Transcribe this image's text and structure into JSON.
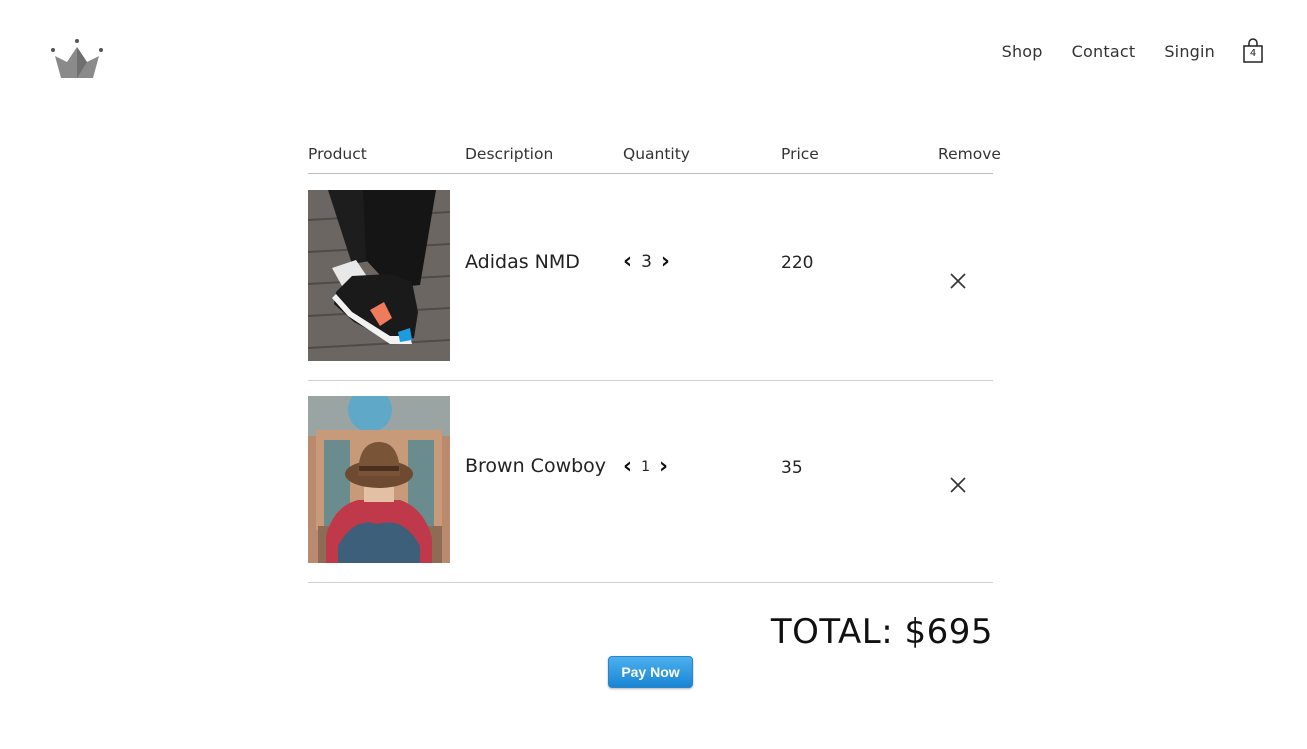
{
  "header": {
    "logo_icon": "crown-icon",
    "nav": [
      {
        "label": "Shop"
      },
      {
        "label": "Contact"
      },
      {
        "label": "Singin"
      }
    ],
    "cart": {
      "icon": "shopping-bag-icon",
      "count": "4"
    }
  },
  "cart_table": {
    "headers": [
      "Product",
      "Description",
      "Quantity",
      "Price",
      "Remove"
    ],
    "rows": [
      {
        "description": "Adidas NMD",
        "quantity": "3",
        "price": "220",
        "image": "sneaker-photo"
      },
      {
        "description": "Brown Cowboy",
        "quantity": "1",
        "price": "35",
        "image": "cowboy-hat-photo"
      }
    ]
  },
  "summary": {
    "total": "TOTAL: $695",
    "pay_label": "Pay Now"
  },
  "colors": {
    "pay_button": "#2a8fdc",
    "divider": "#cfcfcf"
  }
}
